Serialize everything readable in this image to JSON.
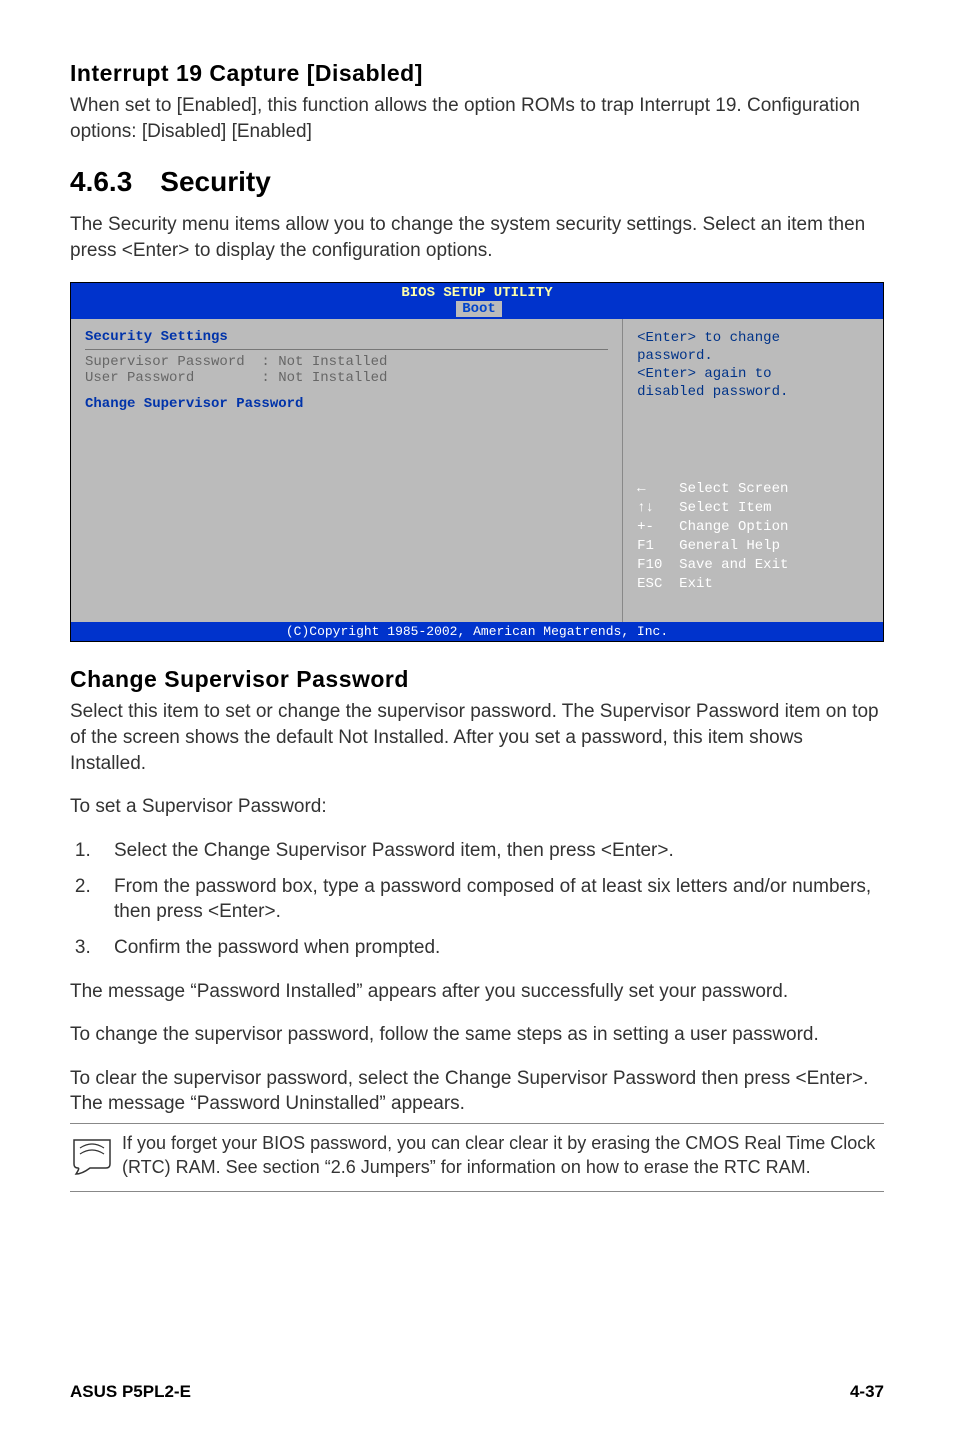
{
  "interrupt": {
    "title": "Interrupt 19 Capture [Disabled]",
    "desc": "When set to [Enabled], this function allows the option ROMs to trap Interrupt 19. Configuration options: [Disabled] [Enabled]"
  },
  "security": {
    "num": "4.6.3",
    "title": "Security",
    "intro": "The Security menu items allow you to change the system security settings. Select an item then press <Enter> to display the configuration options."
  },
  "bios": {
    "header_title": "BIOS SETUP UTILITY",
    "tab": "Boot",
    "heading": "Security Settings",
    "row1": "Supervisor Password  : Not Installed",
    "row2": "User Password        : Not Installed",
    "change_item": "Change Supervisor Password",
    "help_l1": "<Enter> to change",
    "help_l2": "password.",
    "help_l3": "<Enter> again to",
    "help_l4": "disabled password.",
    "nav_l1": "←    Select Screen",
    "nav_l2": "↑↓   Select Item",
    "nav_l3": "+-   Change Option",
    "nav_l4": "F1   General Help",
    "nav_l5": "F10  Save and Exit",
    "nav_l6": "ESC  Exit",
    "footer": "(C)Copyright 1985-2002, American Megatrends, Inc."
  },
  "change_sup": {
    "title": "Change Supervisor Password",
    "p1": "Select this item to set or change the supervisor password. The Supervisor Password item on top of the screen shows the default Not Installed. After you set a password, this item shows Installed.",
    "p2": "To set a Supervisor Password:",
    "step1": "Select the Change Supervisor Password item, then press <Enter>.",
    "step2": "From the password box, type a password composed of at least six letters and/or numbers, then press <Enter>.",
    "step3": "Confirm the password when prompted.",
    "p3": "The message “Password Installed” appears after you successfully set your password.",
    "p4": "To change the supervisor password, follow the same steps as in setting a user password.",
    "p5": "To clear the supervisor password, select the Change Supervisor Password then press <Enter>. The message “Password Uninstalled” appears.",
    "note": "If you forget your BIOS password, you can clear clear it by erasing the CMOS Real Time Clock (RTC) RAM. See section “2.6  Jumpers” for information on how to erase the RTC RAM."
  },
  "footer": {
    "left": "ASUS P5PL2-E",
    "right": "4-37"
  }
}
